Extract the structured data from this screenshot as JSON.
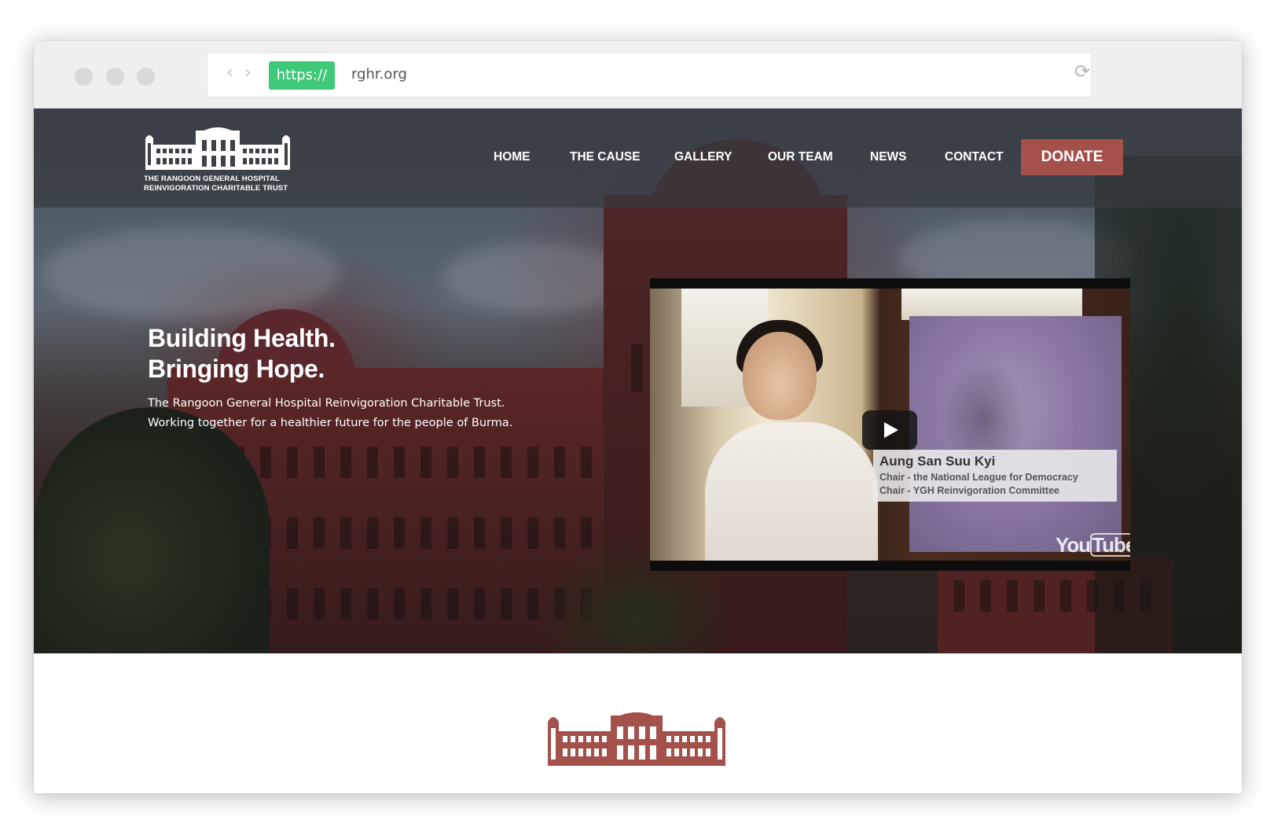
{
  "browser": {
    "protocol": "https://",
    "url": "rghr.org"
  },
  "site": {
    "logo_line1": "THE RANGOON GENERAL HOSPITAL",
    "logo_line2": "REINVIGORATION CHARITABLE TRUST",
    "nav": [
      {
        "label": "HOME"
      },
      {
        "label": "THE CAUSE"
      },
      {
        "label": "GALLERY"
      },
      {
        "label": "OUR TEAM"
      },
      {
        "label": "NEWS"
      },
      {
        "label": "CONTACT"
      }
    ],
    "donate_label": "DONATE"
  },
  "hero": {
    "title_line1": "Building Health.",
    "title_line2": "Bringing Hope.",
    "sub_line1": "The Rangoon General Hospital Reinvigoration Charitable Trust.",
    "sub_line2": "Working together for a healthier future for the people of Burma."
  },
  "video": {
    "caption_name": "Aung San Suu Kyi",
    "caption_line1": "Chair - the National League for Democracy",
    "caption_line2": "Chair - YGH Reinvigoration Committee",
    "brand_you": "You",
    "brand_tube": "Tube"
  },
  "colors": {
    "accent": "#a4504b",
    "https_badge": "#3ec878",
    "footer_logo": "#a4504b"
  }
}
